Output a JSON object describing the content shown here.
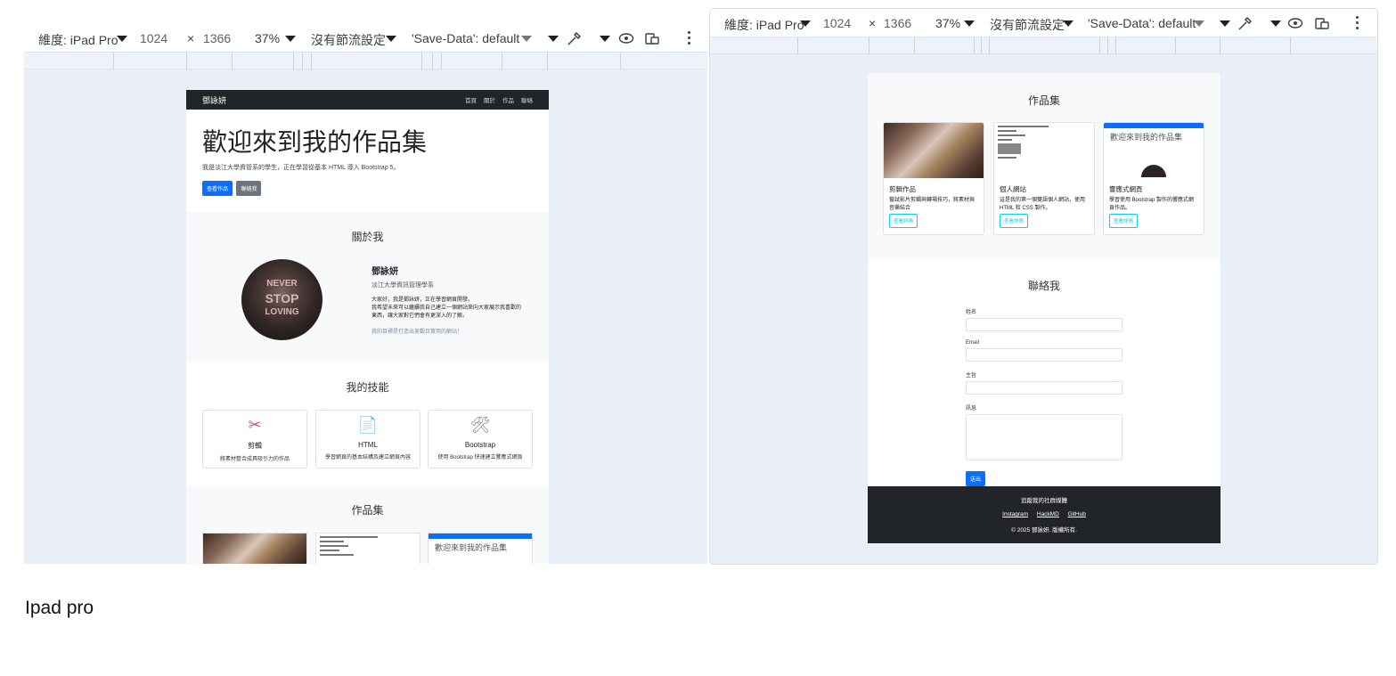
{
  "devtools": {
    "dimensions_label": "維度: iPad Pro",
    "width": "1024",
    "times": "×",
    "height": "1366",
    "zoom": "37%",
    "throttle": "沒有節流設定",
    "save_data": "'Save-Data': default"
  },
  "site": {
    "brand": "鄧詠妍",
    "nav": [
      "首頁",
      "關於",
      "作品",
      "聯絡"
    ],
    "hero_title": "歡迎來到我的作品集",
    "hero_subtitle": "我是淡江大學資管系的學生，正在學習從基本 HTML 導入 Bootstrap 5。",
    "hero_buttons": [
      "查看作品",
      "聯絡我"
    ],
    "about_title": "關於我",
    "avatar_sign": [
      "NEVER",
      "STOP",
      "LOVING"
    ],
    "about_name": "鄧詠妍",
    "about_dept": "淡江大學資訊管理學系",
    "about_bio": [
      "大家好，我是鄧詠妍，正在學習網頁開發。",
      "我希望未來可以繼續我自己建立一個網站來向大家展示我喜歡的",
      "東西，讓大家對它們會有更深入的了解。"
    ],
    "about_note": "我的目標是打造出美觀且實用的網站！",
    "skills_title": "我的技能",
    "skills": [
      {
        "icon": "✂",
        "title": "剪輯",
        "desc": "將素材整合成具吸引力的作品"
      },
      {
        "icon": "📄",
        "title": "HTML",
        "desc": "學習網頁的基本結構及建立網頁內容"
      },
      {
        "icon": "🛠",
        "title": "Bootstrap",
        "desc": "使用 Bootstrap 快速建立響應式網頁"
      }
    ],
    "portfolio_title": "作品集",
    "portfolio_thumb_text": "歡迎來到我的作品集",
    "portfolio": [
      {
        "title": "剪輯作品",
        "desc": "嘗試影片剪輯與轉場技巧，將素材與音樂結合",
        "button": "查看詳情"
      },
      {
        "title": "個人網站",
        "desc": "這是我的第一個雙語個人網站，使用 HTML 和 CSS 製作。",
        "button": "查看詳情"
      },
      {
        "title": "響應式網頁",
        "desc": "學習使用 Bootstrap 製作的響應式網頁作品。",
        "button": "查看詳情"
      }
    ],
    "contact_title": "聯絡我",
    "contact_labels": [
      "姓名",
      "Email",
      "主旨",
      "訊息"
    ],
    "contact_send": "送出",
    "footer_heading": "追蹤我的社群媒體",
    "footer_links": [
      "Instagram",
      "HackMD",
      "GitHub"
    ],
    "footer_copy": "© 2025 鄧詠妍. 版權所有."
  },
  "caption": "Ipad pro",
  "colors": {
    "primary": "#0d6efd",
    "dark": "#212529",
    "info": "#0dcaf0",
    "canvas": "#eaeef6"
  }
}
